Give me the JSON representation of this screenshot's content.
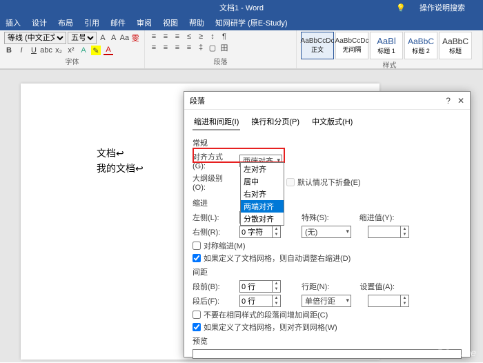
{
  "title": "文档1 - Word",
  "helpSearch": "操作说明搜索",
  "tabs": [
    "插入",
    "设计",
    "布局",
    "引用",
    "邮件",
    "审阅",
    "视图",
    "帮助",
    "知网研学 (原E-Study)"
  ],
  "font": {
    "name": "等线 (中文正文)",
    "size": "五号",
    "groupLabel": "字体"
  },
  "para": {
    "groupLabel": "段落"
  },
  "styles": {
    "groupLabel": "样式",
    "items": [
      {
        "sample": "AaBbCcDc",
        "name": "正文"
      },
      {
        "sample": "AaBbCcDc",
        "name": "无间隔"
      },
      {
        "sample": "AaBl",
        "name": "标题 1"
      },
      {
        "sample": "AaBbC",
        "name": "标题 2"
      },
      {
        "sample": "AaBbC",
        "name": "标题"
      }
    ]
  },
  "doc": {
    "line1": "文档",
    "line2": "我的文档"
  },
  "dialog": {
    "title": "段落",
    "tabs": [
      "缩进和间距(I)",
      "换行和分页(P)",
      "中文版式(H)"
    ],
    "section_general": "常规",
    "align_label": "对齐方式(G):",
    "align_value": "两端对齐",
    "align_options": [
      "左对齐",
      "居中",
      "右对齐",
      "两端对齐",
      "分散对齐"
    ],
    "outline_label": "大纲级别(O):",
    "collapse_label": "默认情况下折叠(E)",
    "section_indent": "缩进",
    "left_label": "左侧(L):",
    "right_label": "右侧(R):",
    "zero_char": "0 字符",
    "special_label": "特殊(S):",
    "special_value": "(无)",
    "indent_val_label": "缩进值(Y):",
    "mirror_label": "对称缩进(M)",
    "grid_indent_label": "如果定义了文档网格，则自动调整右缩进(D)",
    "section_spacing": "间距",
    "before_label": "段前(B):",
    "after_label": "段后(F):",
    "zero_line": "0 行",
    "linespace_label": "行距(N):",
    "linespace_value": "单倍行距",
    "setval_label": "设置值(A):",
    "nosamespace_label": "不要在相同样式的段落间增加间距(C)",
    "grid_align_label": "如果定义了文档网格，则对齐到网格(W)",
    "preview_label": "预览"
  },
  "watermark": "PConline"
}
